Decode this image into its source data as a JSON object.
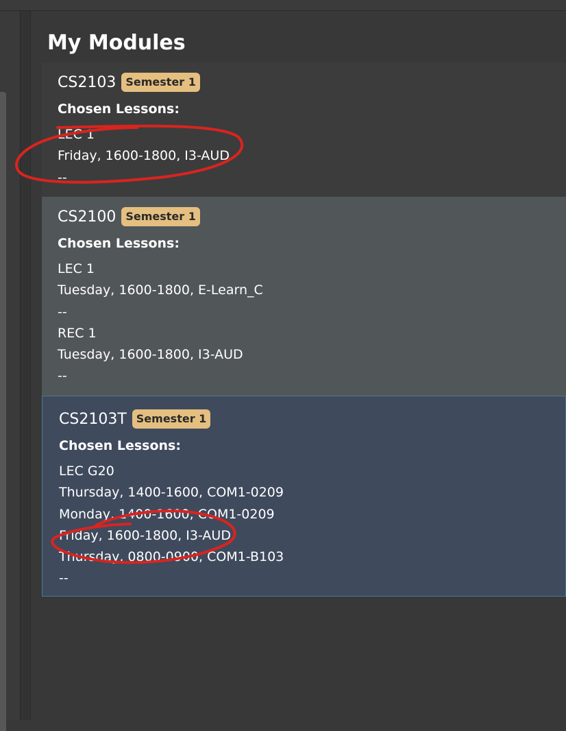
{
  "page": {
    "title": "My Modules"
  },
  "modules": [
    {
      "code": "CS2103",
      "semester": "Semester 1",
      "chosen_label": "Chosen Lessons:",
      "lines": [
        "LEC 1",
        "Friday, 1600-1800, I3-AUD",
        "--"
      ]
    },
    {
      "code": "CS2100",
      "semester": "Semester 1",
      "chosen_label": "Chosen Lessons:",
      "lines": [
        "LEC 1",
        "Tuesday, 1600-1800, E-Learn_C",
        "--",
        "REC 1",
        "Tuesday, 1600-1800, I3-AUD",
        "--"
      ]
    },
    {
      "code": "CS2103T",
      "semester": "Semester 1",
      "chosen_label": "Chosen Lessons:",
      "lines": [
        "LEC G20",
        "Thursday, 1400-1600, COM1-0209",
        "Monday, 1400-1600, COM1-0209",
        "Friday, 1600-1800, I3-AUD",
        "Thursday, 0800-0900, COM1-B103",
        "--"
      ]
    }
  ],
  "colors": {
    "background": "#383838",
    "card_1": "#3c3c3c",
    "card_2": "#515658",
    "card_3_selected": "#3f4a5d",
    "badge": "#e5bf80",
    "annotation": "#d9241f"
  }
}
